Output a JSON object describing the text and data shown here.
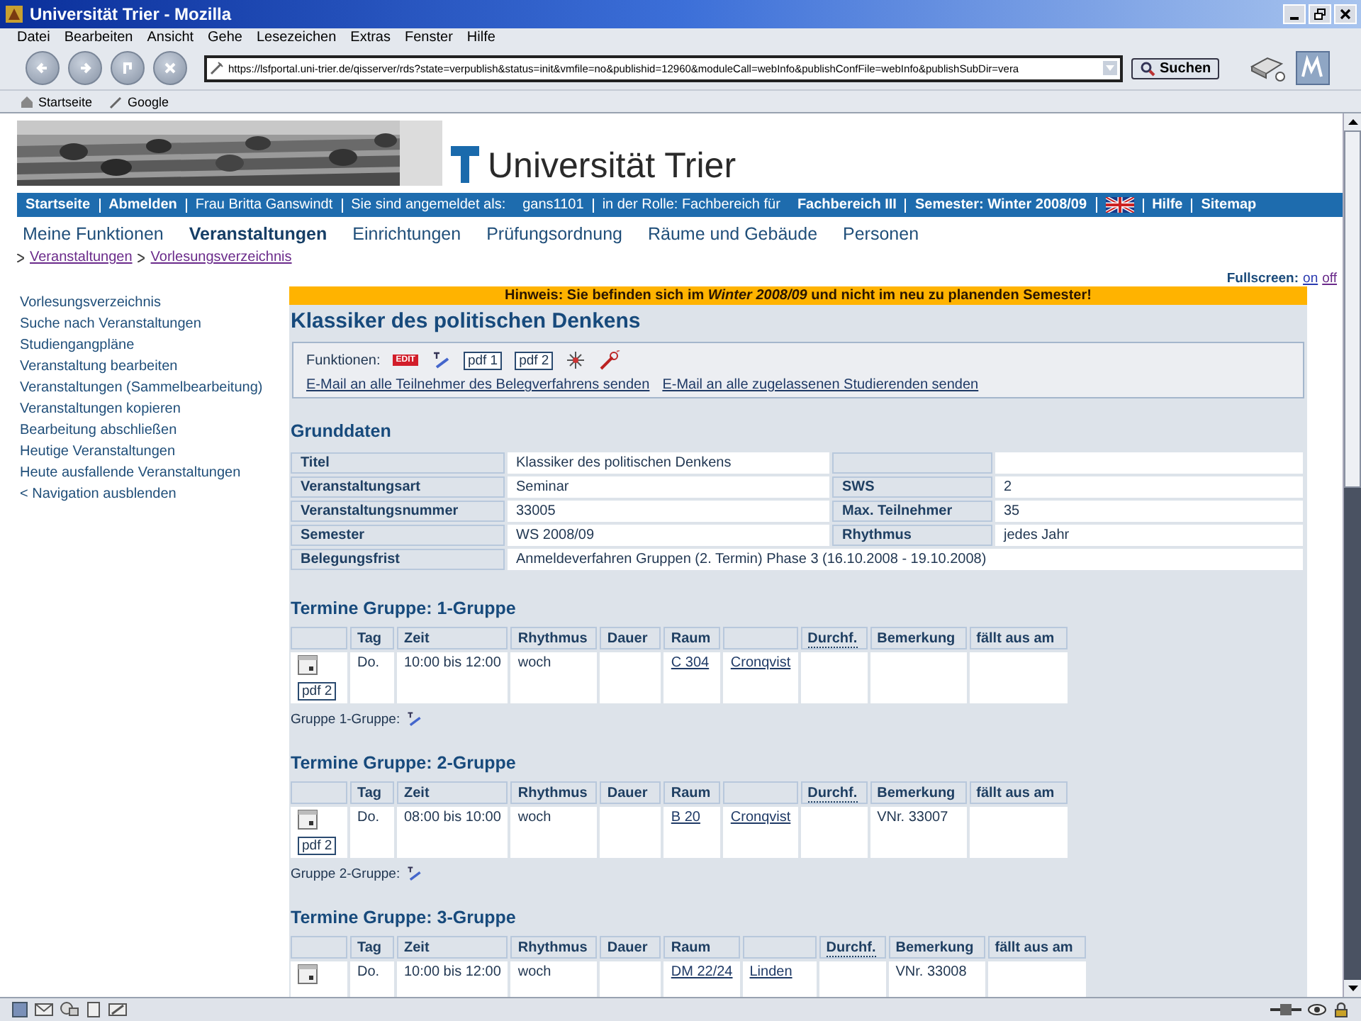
{
  "window": {
    "title": "Universität Trier - Mozilla"
  },
  "menu": [
    "Datei",
    "Bearbeiten",
    "Ansicht",
    "Gehe",
    "Lesezeichen",
    "Extras",
    "Fenster",
    "Hilfe"
  ],
  "toolbar": {
    "url": "https://lsfportal.uni-trier.de/qisserver/rds?state=verpublish&status=init&vmfile=no&publishid=12960&moduleCall=webInfo&publishConfFile=webInfo&publishSubDir=vera",
    "search_button": "Suchen"
  },
  "bookmarks": [
    "Startseite",
    "Google"
  ],
  "site": {
    "logo": "Universität Trier",
    "userbar": [
      {
        "kind": "link",
        "text": "Startseite"
      },
      {
        "kind": "link",
        "text": "Abmelden"
      },
      {
        "kind": "plain",
        "text": "Frau Britta Ganswindt"
      },
      {
        "kind": "pair",
        "text": "Sie sind angemeldet als:",
        "value": "gans1101",
        "bold": false
      },
      {
        "kind": "pair",
        "text": "in der Rolle: Fachbereich für",
        "value": "Fachbereich III",
        "bold": true
      },
      {
        "kind": "link",
        "text": "Semester: Winter 2008/09"
      },
      {
        "kind": "flag"
      },
      {
        "kind": "link",
        "text": "Hilfe"
      },
      {
        "kind": "link",
        "text": "Sitemap"
      }
    ],
    "tabs": [
      {
        "label": "Meine Funktionen",
        "selected": false
      },
      {
        "label": "Veranstaltungen",
        "selected": true
      },
      {
        "label": "Einrichtungen",
        "selected": false
      },
      {
        "label": "Prüfungsordnung",
        "selected": false
      },
      {
        "label": "Räume und Gebäude",
        "selected": false
      },
      {
        "label": "Personen",
        "selected": false
      }
    ],
    "breadcrumb": [
      "Veranstaltungen",
      "Vorlesungsverzeichnis"
    ],
    "fullscreen": {
      "label": "Fullscreen:",
      "on": "on",
      "off": "off"
    },
    "sidebar": [
      "Vorlesungsverzeichnis",
      "Suche nach Veranstaltungen",
      "Studiengangpläne",
      "Veranstaltung bearbeiten",
      "Veranstaltungen (Sammelbearbeitung)",
      "Veranstaltungen kopieren",
      "Bearbeitung abschließen",
      "Heutige Veranstaltungen",
      "Heute ausfallende Veranstaltungen",
      "< Navigation ausblenden"
    ],
    "notice": "Hinweis: Sie befinden sich im *Winter 2008/09* und nicht im neu zu planenden Semester!",
    "title": "Klassiker des politischen Denkens",
    "functions": {
      "label": "Funktionen:",
      "edit_badge": "EDIT",
      "buttons": [
        "pdf 1",
        "pdf 2"
      ],
      "links": [
        "E-Mail an alle Teilnehmer des Belegverfahrens senden",
        "E-Mail an alle zugelassenen Studierenden senden"
      ]
    },
    "grunddaten": {
      "heading": "Grunddaten",
      "rows": [
        {
          "cells": [
            {
              "kind": "label",
              "text": "Titel"
            },
            {
              "kind": "value",
              "text": "Klassiker des politischen Denkens"
            },
            {
              "kind": "label"
            },
            {
              "kind": "value"
            }
          ]
        },
        {
          "cells": [
            {
              "kind": "label",
              "text": "Veranstaltungsart"
            },
            {
              "kind": "value",
              "text": "Seminar"
            },
            {
              "kind": "label",
              "text": "SWS"
            },
            {
              "kind": "value",
              "text": "2"
            }
          ]
        },
        {
          "cells": [
            {
              "kind": "label",
              "text": "Veranstaltungsnummer"
            },
            {
              "kind": "value",
              "text": "33005"
            },
            {
              "kind": "label",
              "text": "Max. Teilnehmer"
            },
            {
              "kind": "value",
              "text": "35"
            }
          ]
        },
        {
          "cells": [
            {
              "kind": "label",
              "text": "Semester"
            },
            {
              "kind": "value",
              "text": "WS 2008/09"
            },
            {
              "kind": "label",
              "text": "Rhythmus"
            },
            {
              "kind": "value",
              "text": "jedes Jahr"
            }
          ]
        },
        {
          "cells": [
            {
              "kind": "label",
              "text": "Belegungsfrist"
            },
            {
              "kind": "value",
              "text": "Anmeldeverfahren Gruppen (2. Termin) Phase 3 (16.10.2008 - 19.10.2008)",
              "colspan": 3
            }
          ]
        }
      ]
    },
    "groups": [
      {
        "heading": "Termine Gruppe: 1-Gruppe",
        "columns": [
          "",
          "Tag",
          "Zeit",
          "Rhythmus",
          "Dauer",
          "Raum",
          "",
          "Durchf.",
          "Bemerkung",
          "fällt aus am"
        ],
        "row": {
          "pdf": "pdf 2",
          "tag": "Do.",
          "zeit": "10:00 bis 12:00",
          "rhythmus": "woch",
          "raum": "C 304",
          "person": "Cronqvist"
        },
        "footer": "Gruppe 1-Gruppe:"
      },
      {
        "heading": "Termine Gruppe: 2-Gruppe",
        "columns": [
          "",
          "Tag",
          "Zeit",
          "Rhythmus",
          "Dauer",
          "Raum",
          "",
          "Durchf.",
          "Bemerkung",
          "fällt aus am"
        ],
        "row": {
          "pdf": "pdf 2",
          "tag": "Do.",
          "zeit": "08:00 bis 10:00",
          "rhythmus": "woch",
          "raum": "B 20",
          "person": "Cronqvist",
          "bemerkung": "VNr. 33007"
        },
        "footer": "Gruppe 2-Gruppe:"
      },
      {
        "heading": "Termine Gruppe: 3-Gruppe",
        "columns": [
          "",
          "Tag",
          "Zeit",
          "Rhythmus",
          "Dauer",
          "Raum",
          "",
          "Durchf.",
          "Bemerkung",
          "fällt aus am"
        ],
        "row": {
          "tag": "Do.",
          "zeit": "10:00 bis 12:00",
          "rhythmus": "woch",
          "raum": "DM 22/24",
          "person": "Linden",
          "bemerkung": "VNr. 33008"
        }
      }
    ]
  }
}
